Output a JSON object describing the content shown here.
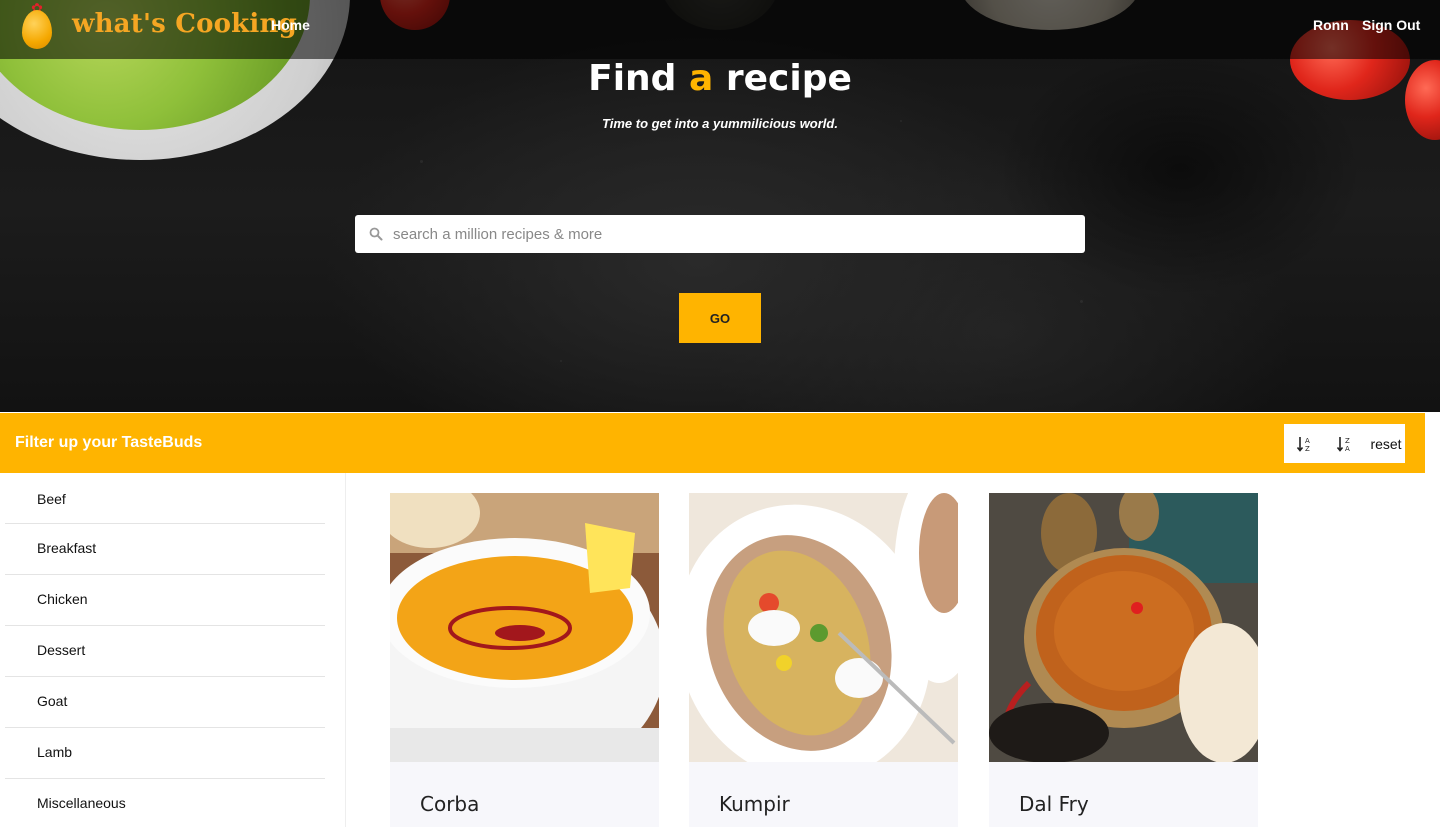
{
  "nav": {
    "logo_text": "what's Cooking",
    "home_label": "Home",
    "user_name": "Ronn",
    "signout_label": "Sign Out"
  },
  "hero": {
    "title_pre": "Find",
    "title_accent": "a",
    "title_post": "recipe",
    "subtitle": "Time to get into a yummilicious world.",
    "search_placeholder": "search a million recipes & more",
    "go_label": "GO"
  },
  "filter": {
    "title": "Filter up your TasteBuds",
    "sort_az_icon": "sort-alpha-asc-icon",
    "sort_za_icon": "sort-alpha-desc-icon",
    "reset_label": "reset"
  },
  "categories": [
    {
      "label": "Beef"
    },
    {
      "label": "Breakfast"
    },
    {
      "label": "Chicken"
    },
    {
      "label": "Dessert"
    },
    {
      "label": "Goat"
    },
    {
      "label": "Lamb"
    },
    {
      "label": "Miscellaneous"
    }
  ],
  "recipes": [
    {
      "title": "Corba"
    },
    {
      "title": "Kumpir"
    },
    {
      "title": "Dal Fry"
    }
  ],
  "colors": {
    "accent": "#ffb400",
    "brand_text": "#f5a623",
    "card_bg": "#f7f7fb"
  }
}
